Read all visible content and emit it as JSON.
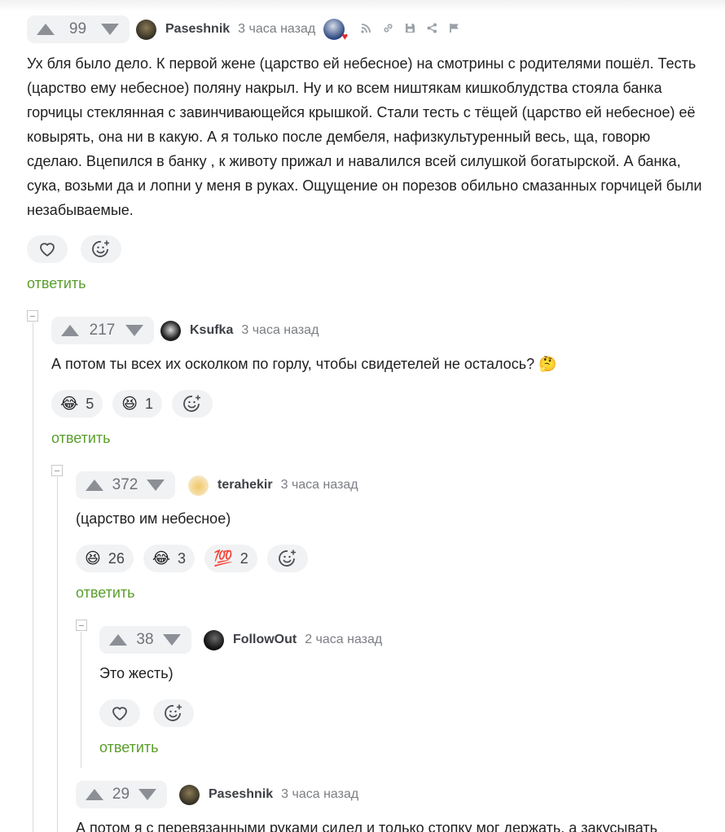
{
  "comments": [
    {
      "rating": "99",
      "author": "Paseshnik",
      "time": "3 часа назад",
      "text": "Ух бля было дело. К первой жене (царство ей небесное) на смотрины с родителями пошёл. Тесть (царство ему небесное) поляну накрыл. Ну и ко всем ништякам кишкоблудства стояла банка горчицы стеклянная с завинчивающейся крышкой. Стали тесть с тёщей (царство ей небесное) её ковырять, она ни в какую. А я только после дембеля, нафизкультуренный весь, ща, говорю сделаю. Вцепился в банку , к животу прижал и навалился всей силушкой богатырской. А банка, сука, возьми да и лопни у меня в руках. Ощущение он порезов обильно смазанных горчицей были незабываемые.",
      "reply": "ответить"
    },
    {
      "rating": "217",
      "author": "Ksufka",
      "time": "3 часа назад",
      "text": "А потом ты всех их осколком по горлу, чтобы свидетелей не осталось? 🤔",
      "reactions": [
        {
          "emoji": "😂",
          "count": "5"
        },
        {
          "emoji": "😆",
          "count": "1"
        }
      ],
      "reply": "ответить"
    },
    {
      "rating": "372",
      "author": "terahekir",
      "time": "3 часа назад",
      "text": "(царство им небесное)",
      "reactions": [
        {
          "emoji": "😆",
          "count": "26"
        },
        {
          "emoji": "😂",
          "count": "3"
        },
        {
          "emoji": "💯",
          "count": "2"
        }
      ],
      "reply": "ответить"
    },
    {
      "rating": "38",
      "author": "FollowOut",
      "time": "2 часа назад",
      "text": "Это жесть)",
      "reply": "ответить"
    },
    {
      "rating": "29",
      "author": "Paseshnik",
      "time": "3 часа назад",
      "text": "А потом я с перевязанными руками сидел и только стопку мог держать, а закусывать"
    }
  ],
  "icons": {
    "badge": "badge-avatar-heart-icon",
    "rss": "rss-icon",
    "link": "link-icon",
    "save": "save-icon",
    "share": "share-icon",
    "report": "flag-icon",
    "like": "heart-icon",
    "add_reaction": "add-reaction-icon"
  },
  "colors": {
    "reply_link": "#5a9e2b",
    "rating_bg": "#f1f2f4",
    "arrow": "#8c9096"
  }
}
